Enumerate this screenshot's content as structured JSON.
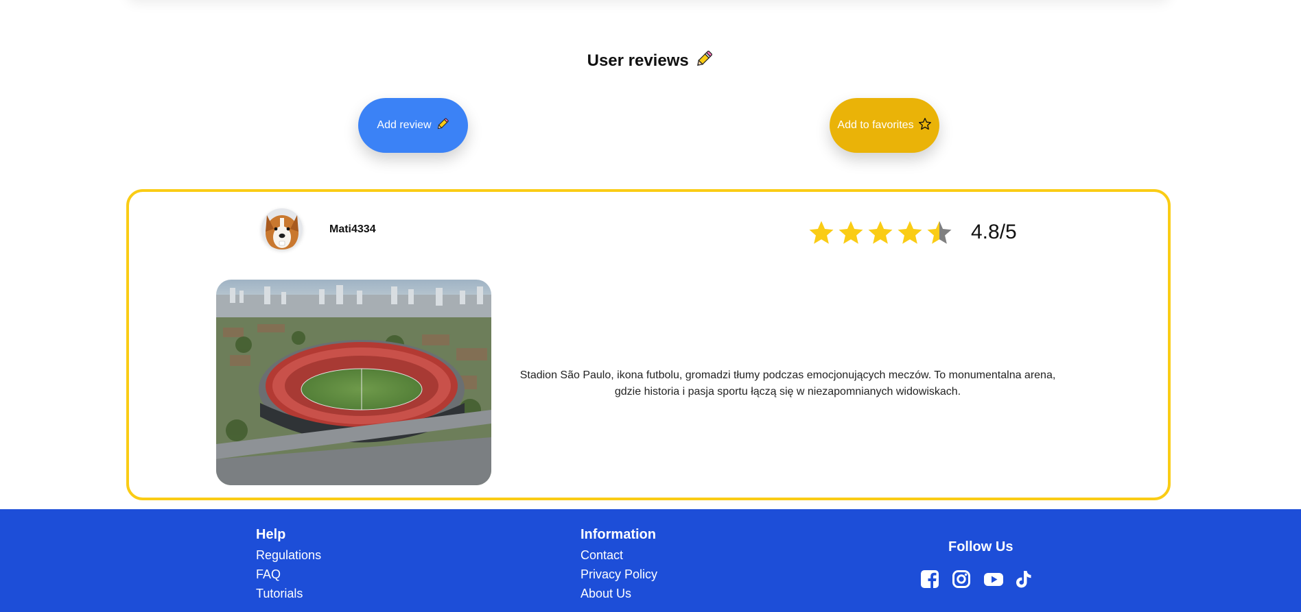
{
  "reviews_section": {
    "title": "User reviews",
    "title_icon": "pencil-icon",
    "add_review_label": "Add review",
    "add_favorites_label": "Add to favorites",
    "favorite_icon": "star-outline-icon"
  },
  "review": {
    "username": "Mati4334",
    "avatar": "dog-avatar",
    "rating": 4.8,
    "rating_text": "4.8/5",
    "star_color": "#facc15",
    "text": "Stadion São Paulo, ikona futbolu, gromadzi tłumy podczas emocjonujących meczów. To monumentalna arena, gdzie historia i pasja sportu łączą się w niezapomnianych widowiskach.",
    "photo": "stadium-aerial-photo"
  },
  "footer": {
    "background": "#1d4ed8",
    "help": {
      "title": "Help",
      "links": [
        "Regulations",
        "FAQ",
        "Tutorials"
      ]
    },
    "information": {
      "title": "Information",
      "links": [
        "Contact",
        "Privacy Policy",
        "About Us"
      ]
    },
    "follow": {
      "title": "Follow Us",
      "icons": [
        "facebook-icon",
        "instagram-icon",
        "youtube-icon",
        "tiktok-icon"
      ]
    }
  }
}
